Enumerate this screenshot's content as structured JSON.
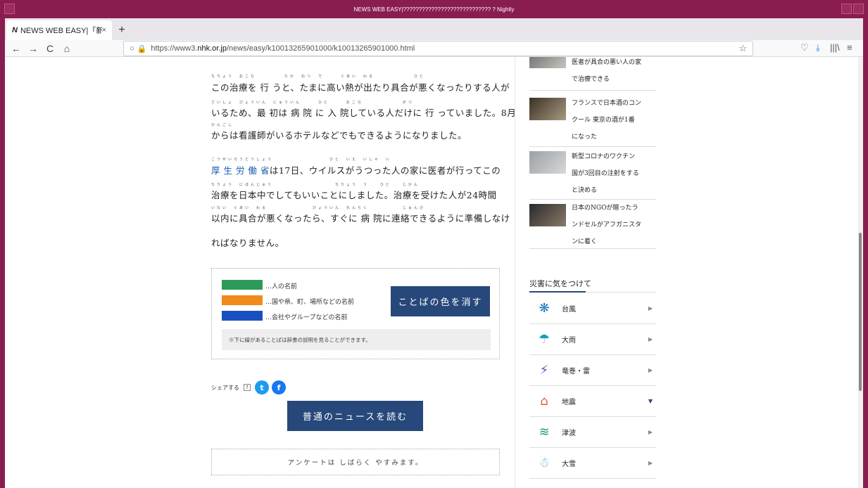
{
  "window": {
    "title": "NEWS WEB EASY|???????????????????????????? ? Nightly"
  },
  "tab": {
    "favicon": "N",
    "title": "NEWS WEB EASY|「新型コロナ」",
    "close": "×",
    "new_tab": "+"
  },
  "nav": {
    "back": "←",
    "forward": "→",
    "reload": "C",
    "home": "⌂",
    "url_prefix": "https://www3.",
    "url_domain": "nhk.or.jp",
    "url_path": "/news/easy/k10013265901000/k10013265901000.html",
    "bookmark": "☆",
    "pocket": "♡",
    "download": "⤓",
    "library": "|||\\",
    "menu": "≡"
  },
  "article": {
    "r1": "ちりょう　おこな　　　　　たか　ねつ　で　　　ぐあい　わる　　　　　　　ひと",
    "l1": "この治療を 行 うと、たまに高い熱が出たり具合が悪くなったりする人が",
    "r2": "さいしょ　びょういん　にゅういん　　　ひと　　　おこな　　　　　　　がつ",
    "l2": "いるため、最 初は 病 院 に 入 院している人だけに 行 っていました。8月",
    "r3": "かんごし",
    "l3": "からは看護師がいるホテルなどでもできるようになりました。",
    "r4": "こうせいろうどうしょう　　　　　　　　　　ひと　いえ　いしゃ　い",
    "l4a": "厚 生 労 働 省",
    "l4b": "は17日、ウイルスがうつった人の家に医者が行ってこの",
    "r5": "ちりょう　にほんじゅう　　　　　　　　　　　ちりょう　う　　ひと　　じかん",
    "l5": "治療を日本中でしてもいいことにしました。治療を受けた人が24時間",
    "r6": "いない　ぐあい　わる　　　　　　　　びょういん　れんらく　　　　　　じゅんび",
    "l6": "以内に具合が悪くなったら、すぐに 病 院に連絡できるように準備しなけ",
    "l7": "ればなりません。"
  },
  "legend": {
    "items": [
      {
        "color": "#2e9a5a",
        "label": "…人の名前"
      },
      {
        "color": "#f08a1c",
        "label": "…国や県、町、場所などの名前"
      },
      {
        "color": "#1a4fc0",
        "label": "…会社やグループなどの名前"
      }
    ],
    "clear_button": "ことばの色を消す",
    "note": "※下に線があることばは辞書の説明を見ることができます。"
  },
  "share": {
    "label": "シェアする",
    "help": "?",
    "twitter": "t",
    "facebook": "f"
  },
  "normal_button": "普通のニュースを読む",
  "survey": "アンケートは しばらく やすみます。",
  "sidebar": {
    "news": [
      {
        "l1": "医者が具合の悪い人の家",
        "l2": "で治療できる"
      },
      {
        "l1": "フランスで日本酒のコン",
        "l2": "クール 東京の酒が1番",
        "l3": "になった"
      },
      {
        "l1": "新型コロナのワクチン",
        "l2": "国が3回目の注射をする",
        "l3": "と決める"
      },
      {
        "l1": "日本のNGOが贈ったラ",
        "l2": "ンドセルがアフガニスタ",
        "l3": "ンに着く"
      }
    ],
    "section_title": "災害に気をつけて",
    "disasters": [
      {
        "name": "台風",
        "icon": "typhoon-icon",
        "glyph": "❋",
        "color": "#1a7ac0",
        "arrow": "▶"
      },
      {
        "name": "大雨",
        "icon": "umbrella-icon",
        "glyph": "☂",
        "color": "#1a9ac0",
        "arrow": "▶"
      },
      {
        "name": "竜巻・雷",
        "icon": "tornado-icon",
        "glyph": "⚡",
        "color": "#5a5ab0",
        "arrow": "▶"
      },
      {
        "name": "地震",
        "icon": "earthquake-icon",
        "glyph": "⌂",
        "color": "#e0603a",
        "arrow": "▼"
      },
      {
        "name": "津波",
        "icon": "tsunami-icon",
        "glyph": "≋",
        "color": "#1a9a7a",
        "arrow": "▶"
      },
      {
        "name": "大雪",
        "icon": "snow-icon",
        "glyph": "☃",
        "color": "#5aaad0",
        "arrow": "▶"
      }
    ]
  }
}
